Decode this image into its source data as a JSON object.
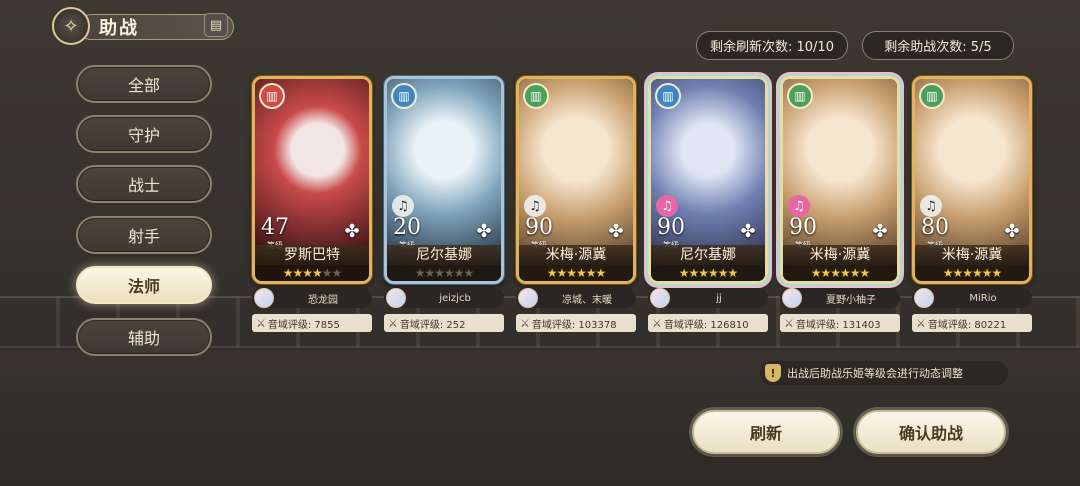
{
  "header": {
    "title": "助战",
    "emblem_icon": "compass-emblem-icon",
    "book_icon": "notebook-icon"
  },
  "counters": {
    "refresh": "剩余刷新次数: 10/10",
    "assist": "剩余助战次数: 5/5"
  },
  "sidebar": {
    "selected": "法师",
    "items": [
      {
        "label": "全部"
      },
      {
        "label": "守护"
      },
      {
        "label": "战士"
      },
      {
        "label": "射手"
      },
      {
        "label": "法师"
      },
      {
        "label": "辅助"
      }
    ]
  },
  "cards": [
    {
      "name": "罗斯巴特",
      "level": "47",
      "level_label": "等级",
      "owner": "恐龙园",
      "rating": "音域评级: 7855",
      "stars_filled": 4,
      "stars_total": 6
    },
    {
      "name": "尼尔基娜",
      "level": "20",
      "level_label": "等级",
      "owner": "jeizjcb",
      "rating": "音域评级: 252",
      "stars_filled": 0,
      "stars_total": 6
    },
    {
      "name": "米梅·源冀",
      "level": "90",
      "level_label": "等级",
      "owner": "凉城、末暖",
      "rating": "音域评级: 103378",
      "stars_filled": 6,
      "stars_total": 6
    },
    {
      "name": "尼尔基娜",
      "level": "90",
      "level_label": "等级",
      "owner": "jj",
      "rating": "音域评级: 126810",
      "stars_filled": 6,
      "stars_total": 6
    },
    {
      "name": "米梅·源冀",
      "level": "90",
      "level_label": "等级",
      "owner": "夏野小柚子",
      "rating": "音域评级: 131403",
      "stars_filled": 6,
      "stars_total": 6
    },
    {
      "name": "米梅·源冀",
      "level": "80",
      "level_label": "等级",
      "owner": "MiRio",
      "rating": "音域评级: 80221",
      "stars_filled": 6,
      "stars_total": 6
    }
  ],
  "hint": "出战后助战乐姬等级会进行动态调整",
  "buttons": {
    "refresh": "刷新",
    "confirm": "确认助战"
  },
  "colors": {
    "active_tab": "#f5edd6",
    "star": "#f3c545",
    "frame_gold": "#e2b35a"
  }
}
